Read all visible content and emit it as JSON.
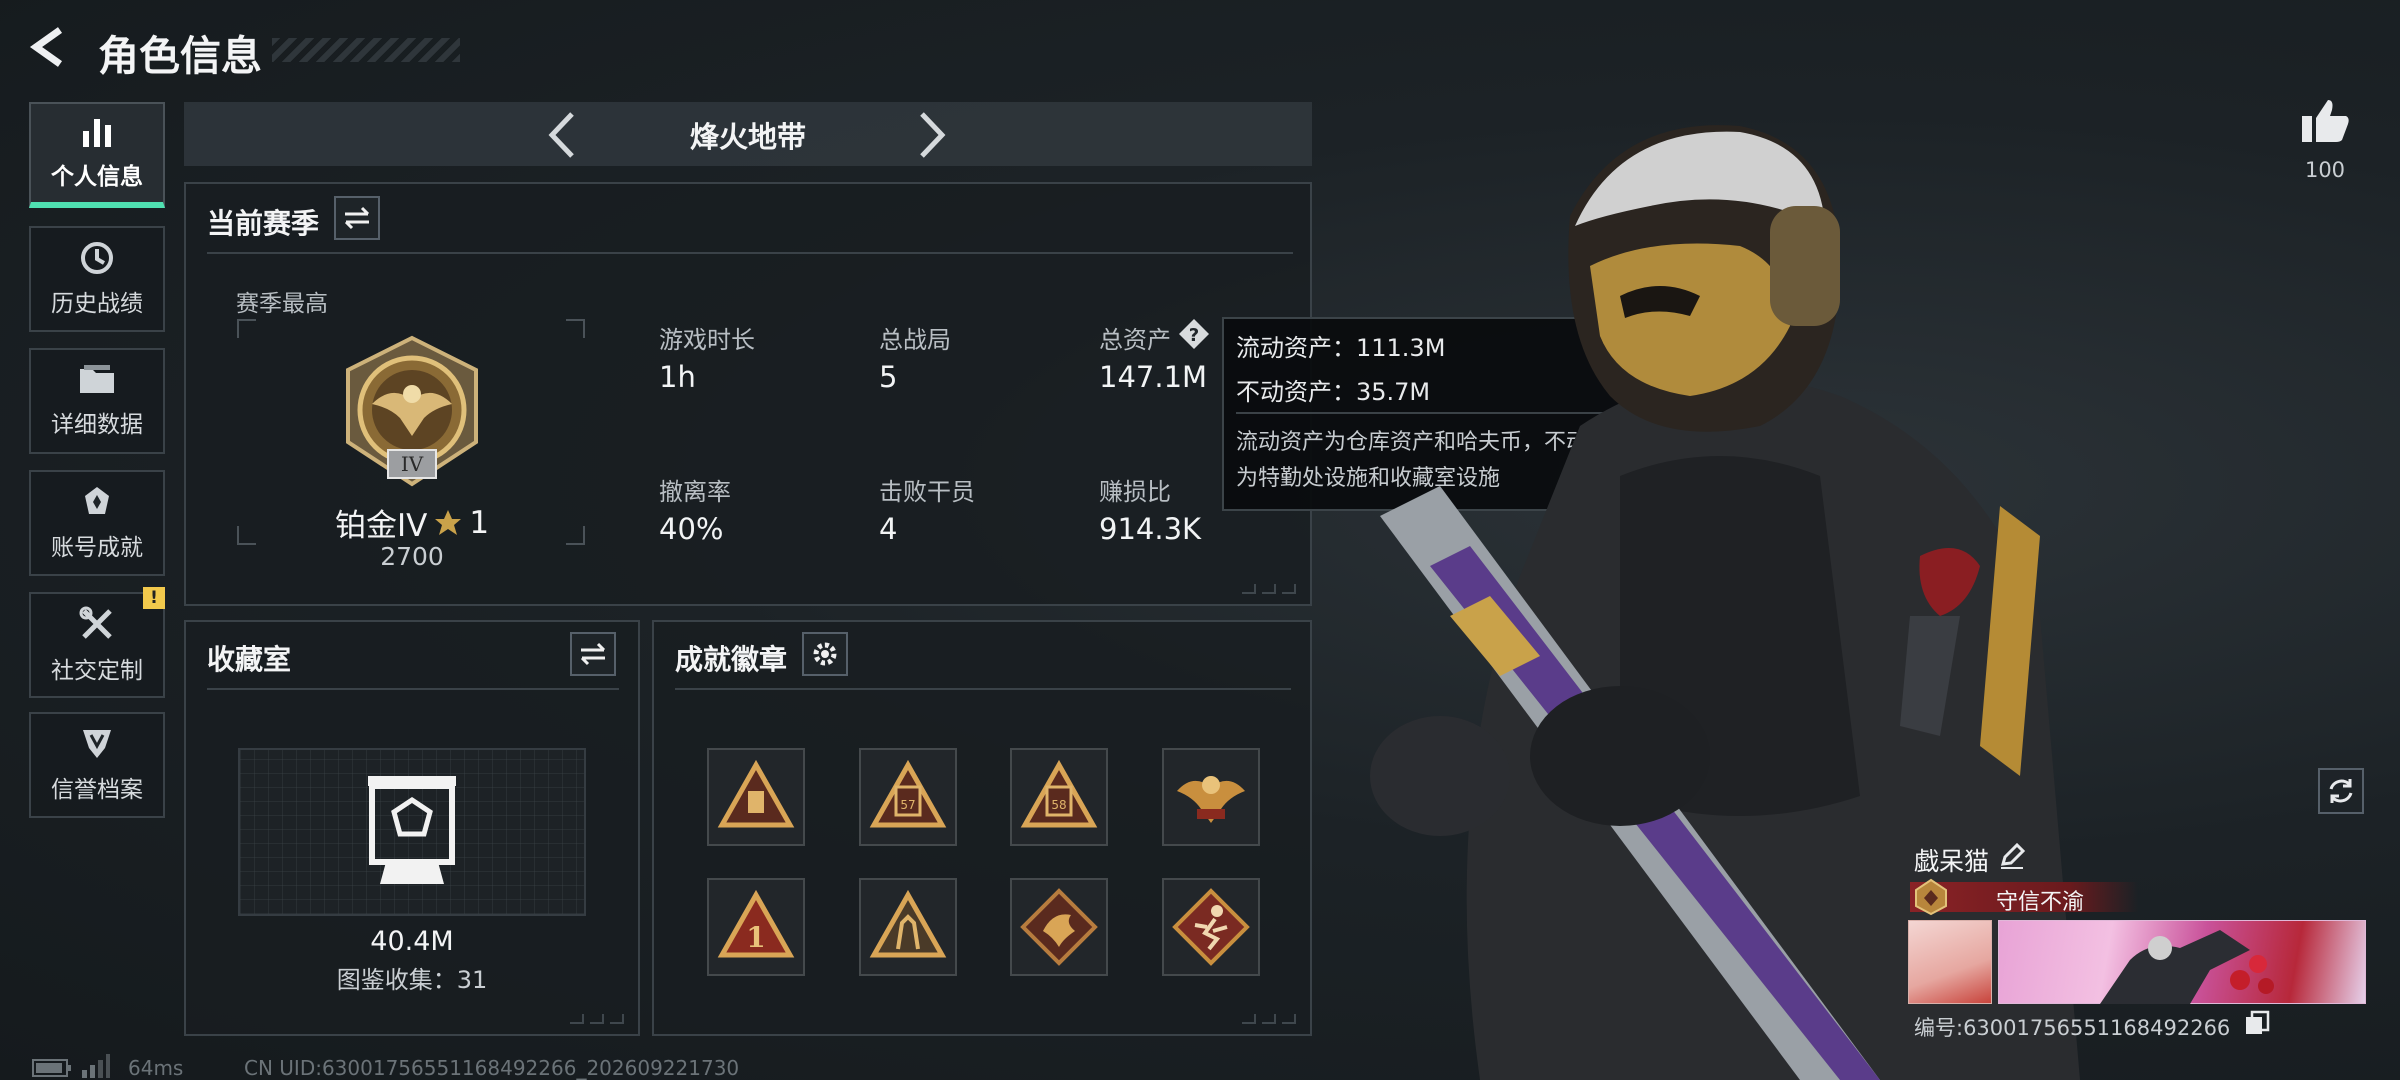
{
  "header": {
    "title": "角色信息"
  },
  "nav": {
    "items": [
      {
        "label": "个人信息",
        "icon": "bar-chart-icon",
        "active": true
      },
      {
        "label": "历史战绩",
        "icon": "history-clock-icon"
      },
      {
        "label": "详细数据",
        "icon": "folder-icon"
      },
      {
        "label": "账号成就",
        "icon": "achievement-icon"
      },
      {
        "label": "社交定制",
        "icon": "tools-icon",
        "alert": "!"
      },
      {
        "label": "信誉档案",
        "icon": "credit-shield-icon"
      }
    ]
  },
  "mode_selector": {
    "current": "烽火地带"
  },
  "season": {
    "title": "当前赛季",
    "best_label": "赛季最高",
    "rank_name": "铂金IV",
    "rank_stars": "1",
    "rank_score": "2700",
    "rank_badge_numeral": "IV",
    "stats": [
      {
        "label": "游戏时长",
        "value": "1h"
      },
      {
        "label": "总战局",
        "value": "5"
      },
      {
        "label": "总资产",
        "value": "147.1M"
      },
      {
        "label": "撤离率",
        "value": "40%"
      },
      {
        "label": "击败干员",
        "value": "4"
      },
      {
        "label": "赚损比",
        "value": "914.3K"
      }
    ]
  },
  "tooltip": {
    "liquid": "流动资产：111.3M",
    "fixed": "不动资产：35.7M",
    "desc_line1": "流动资产为仓库资产和哈夫币，不动资产",
    "desc_line2": "为特勤处设施和收藏室设施"
  },
  "collection": {
    "title": "收藏室",
    "value": "40.4M",
    "count_text": "图鉴收集：31"
  },
  "achievements": {
    "title": "成就徽章",
    "badges": [
      {
        "name": "badge-1",
        "numeral": ""
      },
      {
        "name": "badge-2",
        "numeral": "57"
      },
      {
        "name": "badge-3",
        "numeral": "58"
      },
      {
        "name": "badge-4",
        "numeral": ""
      },
      {
        "name": "badge-5",
        "numeral": "1"
      },
      {
        "name": "badge-6",
        "numeral": ""
      },
      {
        "name": "badge-7",
        "numeral": ""
      },
      {
        "name": "badge-8",
        "numeral": ""
      }
    ]
  },
  "likes": {
    "count": "100"
  },
  "player": {
    "name": "戯呆猫",
    "title": "守信不渝",
    "id_text": "编号:630017565511684922​66"
  },
  "status_bar": {
    "ping": "64ms",
    "uid": "CN UID:630017565511684922​66_202609221730"
  },
  "colors": {
    "accent": "#4fe0b1",
    "gold": "#c9a24a",
    "title_banner": "#7a1f22",
    "alert": "#f2c94c"
  }
}
